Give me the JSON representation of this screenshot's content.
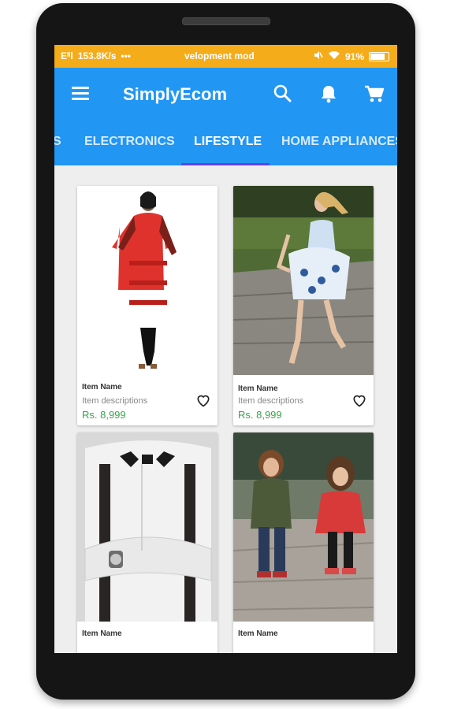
{
  "status_bar": {
    "left_text": "Eᴵᴵl",
    "speed": "153.8K/s",
    "dots": "•••",
    "notification": "velopment mod",
    "battery_percent": "91%",
    "battery_level": 0.91
  },
  "app_bar": {
    "title": "SimplyEcom",
    "menu_icon": "menu-icon",
    "search_icon": "search-icon",
    "bell_icon": "bell-icon",
    "cart_icon": "cart-icon"
  },
  "tabs": [
    {
      "label": "S",
      "active": false
    },
    {
      "label": "ELECTRONICS",
      "active": false
    },
    {
      "label": "LIFESTYLE",
      "active": true
    },
    {
      "label": "HOME APPLIANCES",
      "active": false
    }
  ],
  "products": [
    {
      "name": "Item Name",
      "description": "Item descriptions",
      "price": "Rs. 8,999",
      "image": "red kurta dress"
    },
    {
      "name": "Item Name",
      "description": "Item descriptions",
      "price": "Rs. 8,999",
      "image": "girl in floral dress"
    },
    {
      "name": "Item Name",
      "description": "",
      "price": "",
      "image": "man with bow tie and suspenders"
    },
    {
      "name": "Item Name",
      "description": "",
      "price": "",
      "image": "two children"
    }
  ],
  "colors": {
    "status_bar": "#f5ac1a",
    "app_bar": "#2196f3",
    "tab_indicator": "#6a3ee0",
    "price": "#3aa34a"
  }
}
